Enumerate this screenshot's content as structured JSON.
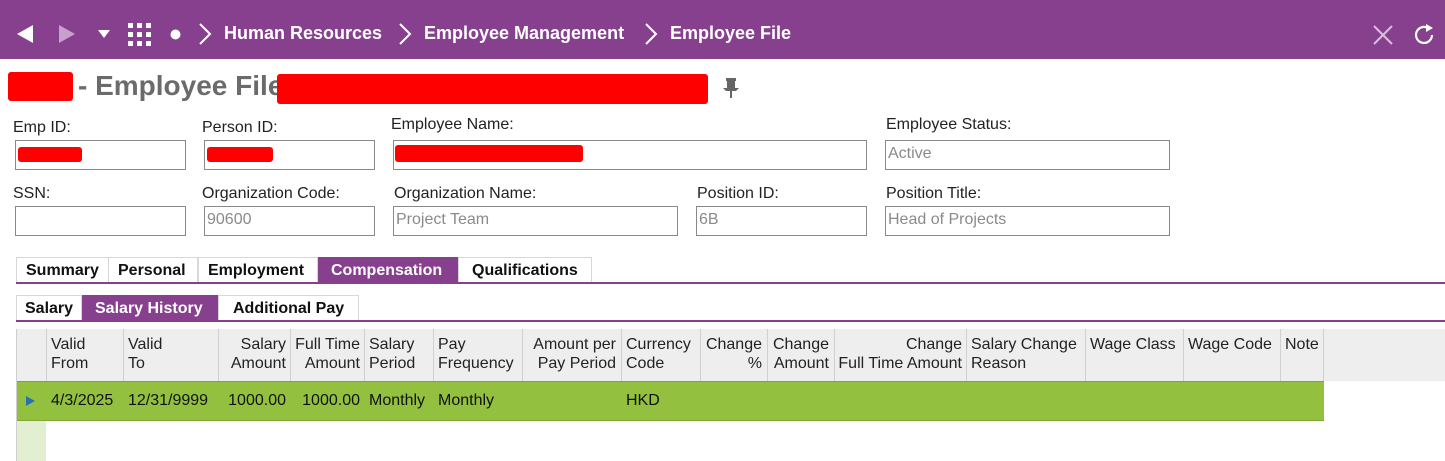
{
  "nav": {
    "breadcrumbs": [
      "Human Resources",
      "Employee Management",
      "Employee File"
    ]
  },
  "title": {
    "middle": "- Employee File -"
  },
  "fields": {
    "emp_id": {
      "label": "Emp ID:",
      "value": ""
    },
    "person_id": {
      "label": "Person ID:",
      "value": ""
    },
    "employee_name": {
      "label": "Employee Name:",
      "value": ""
    },
    "employee_status": {
      "label": "Employee Status:",
      "value": "Active"
    },
    "ssn": {
      "label": "SSN:",
      "value": ""
    },
    "org_code": {
      "label": "Organization Code:",
      "value": "90600"
    },
    "org_name": {
      "label": "Organization Name:",
      "value": "Project Team"
    },
    "position_id": {
      "label": "Position ID:",
      "value": "6B"
    },
    "position_title": {
      "label": "Position Title:",
      "value": "Head of Projects"
    }
  },
  "main_tabs": [
    "Summary",
    "Personal",
    "Employment",
    "Compensation",
    "Qualifications"
  ],
  "main_tab_active": "Compensation",
  "sub_tabs": [
    "Salary",
    "Salary History",
    "Additional Pay"
  ],
  "sub_tab_active": "Salary History",
  "grid": {
    "columns": [
      [
        "Valid",
        "From"
      ],
      [
        "Valid",
        "To"
      ],
      [
        "Salary",
        "Amount"
      ],
      [
        "Full Time",
        "Amount"
      ],
      [
        "Salary",
        "Period"
      ],
      [
        "Pay",
        "Frequency"
      ],
      [
        "Amount per",
        "Pay Period"
      ],
      [
        "Currency",
        "Code"
      ],
      [
        "Change",
        "%"
      ],
      [
        "Change",
        "Amount"
      ],
      [
        "Change",
        "Full Time Amount"
      ],
      [
        "Salary Change",
        "Reason"
      ],
      [
        "Wage Class",
        ""
      ],
      [
        "Wage Code",
        ""
      ],
      [
        "Note",
        ""
      ]
    ],
    "rows": [
      [
        "4/3/2025",
        "12/31/9999",
        "1000.00",
        "1000.00",
        "Monthly",
        "Monthly",
        "",
        "HKD",
        "",
        "",
        "",
        "",
        "",
        "",
        ""
      ]
    ]
  },
  "colors": {
    "brand": "#87408e",
    "row_selected": "#93c13f"
  }
}
